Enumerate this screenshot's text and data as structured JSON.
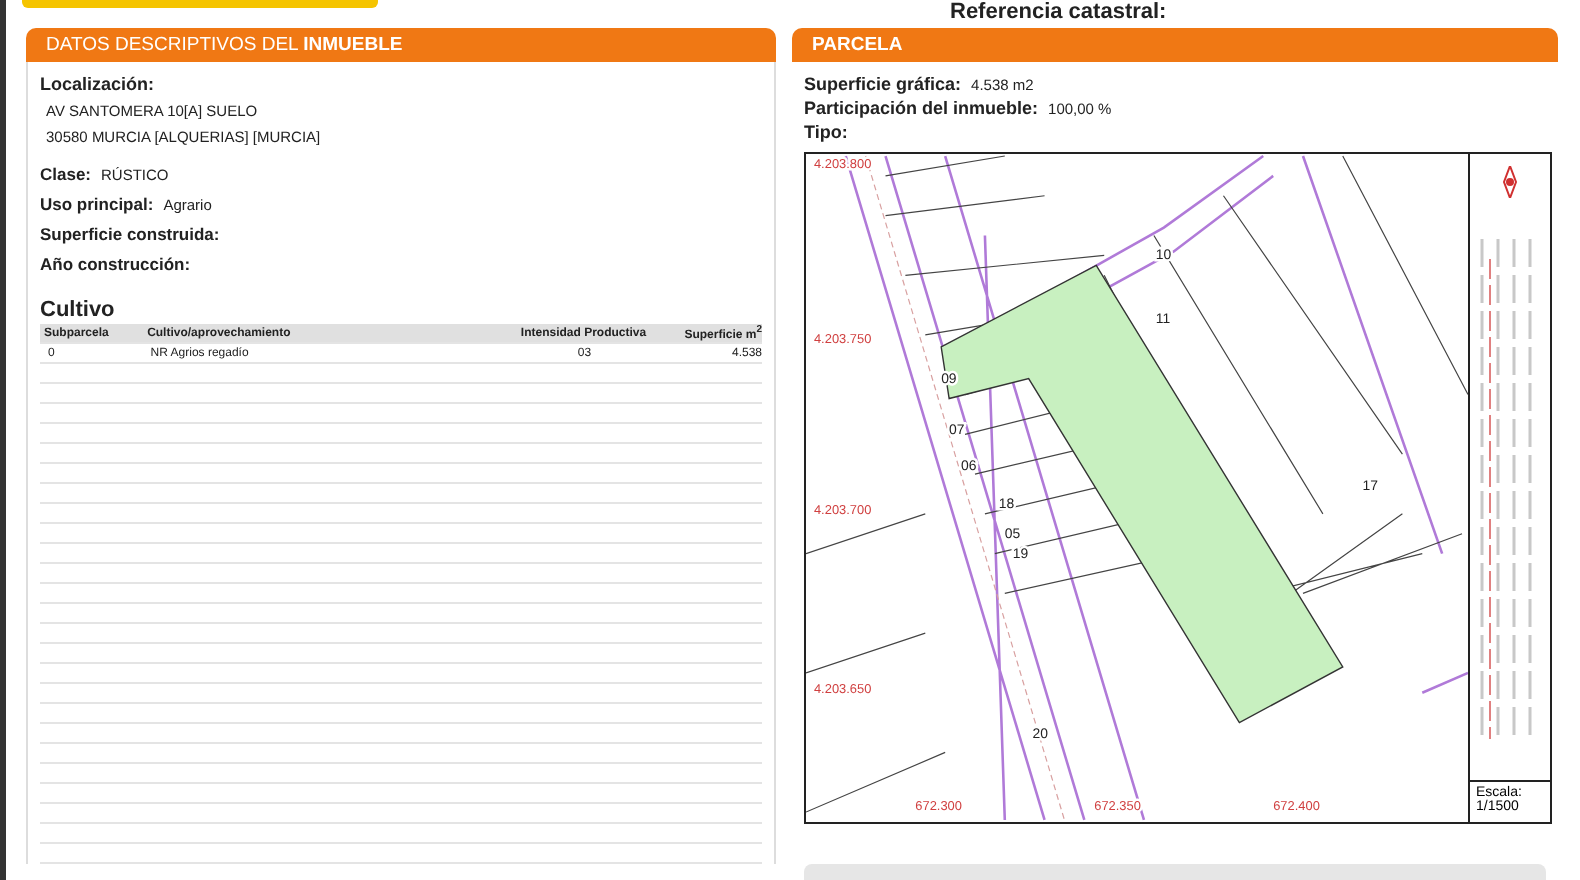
{
  "header": {
    "reference_label": "Referencia catastral:"
  },
  "descriptive": {
    "title": "DATOS DESCRIPTIVOS DEL **INMUEBLE**",
    "location_label": "Localización:",
    "address_lines": [
      "AV SANTOMERA 10[A] SUELO",
      "30580 MURCIA [ALQUERIAS] [MURCIA]"
    ],
    "fields": [
      {
        "label": "Clase:",
        "value": "RÚSTICO"
      },
      {
        "label": "Uso principal:",
        "value": "Agrario"
      },
      {
        "label": "Superficie construida:"
      },
      {
        "label": "Año construcción:"
      }
    ],
    "crop": {
      "title": "Cultivo",
      "columns": [
        "Subparcela",
        "Cultivo/aprovechamiento",
        "Intensidad Productiva",
        "Superficie m$^{2}$"
      ],
      "rows": [
        [
          "0",
          "NR Agrios regadío",
          "03",
          "4.538"
        ]
      ]
    }
  },
  "parcel": {
    "title": "PARCELA",
    "fields": [
      {
        "label": "Superficie gráfica:",
        "value": "4.538 m2"
      },
      {
        "label": "Participación del inmueble:",
        "value": "100,00 %"
      },
      {
        "label": "Tipo:"
      }
    ],
    "map": {
      "y_ticks": [
        "4.203.800",
        "4.203.750",
        "4.203.700",
        "4.203.650"
      ],
      "x_ticks": [
        "672.300",
        "672.350",
        "672.400"
      ],
      "parcel_numbers": [
        "10",
        "11",
        "09",
        "07",
        "06",
        "18",
        "05",
        "19",
        "17",
        "20"
      ],
      "scale_label": "Escala:",
      "scale_value": "1/1500"
    }
  }
}
